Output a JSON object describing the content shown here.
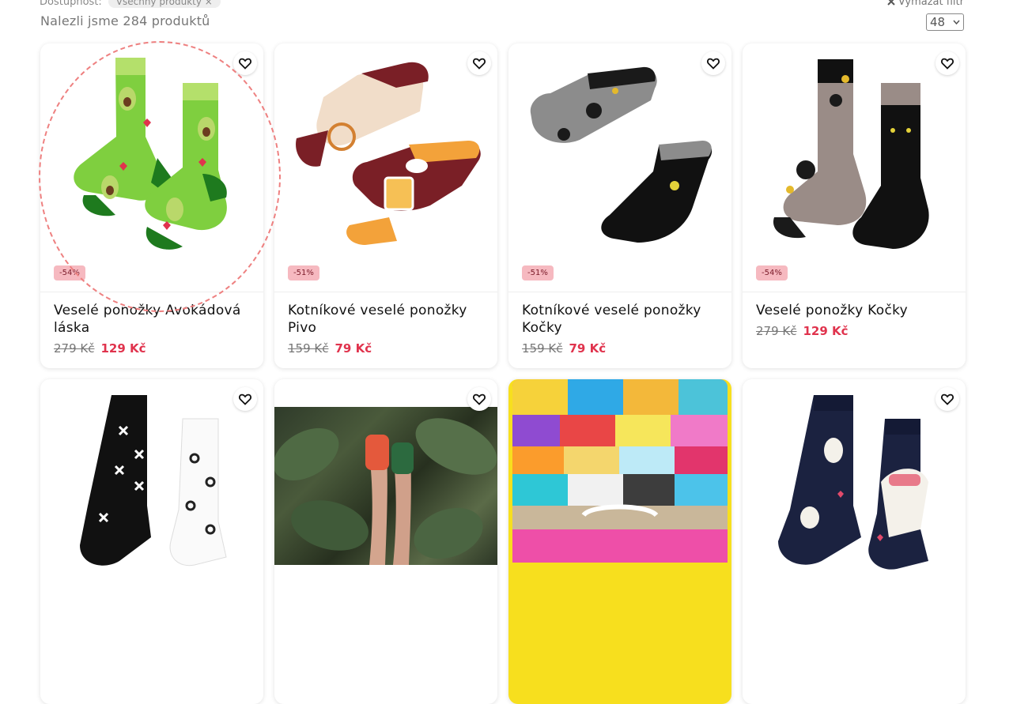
{
  "filters": {
    "label": "Dostupnost:",
    "chip": "Všechny produkty ×",
    "clear": "Vymazat filtr"
  },
  "results": {
    "count_text": "Nalezli jsme 284 produktů",
    "per_page": "48"
  },
  "products": [
    {
      "discount": "-54%",
      "title": "Veselé ponožky Avokádová láska",
      "old_price": "279 Kč",
      "new_price": "129 Kč"
    },
    {
      "discount": "-51%",
      "title": "Kotníkové veselé ponožky Pivo",
      "old_price": "159 Kč",
      "new_price": "79 Kč"
    },
    {
      "discount": "-51%",
      "title": "Kotníkové veselé ponožky Kočky",
      "old_price": "159 Kč",
      "new_price": "79 Kč"
    },
    {
      "discount": "-54%",
      "title": "Veselé ponožky Kočky",
      "old_price": "279 Kč",
      "new_price": "129 Kč"
    }
  ],
  "colors": {
    "accent": "#e0334d",
    "badge": "#f6b9c0"
  },
  "icons": [
    "heart-icon",
    "chevron-down-icon",
    "close-icon"
  ]
}
